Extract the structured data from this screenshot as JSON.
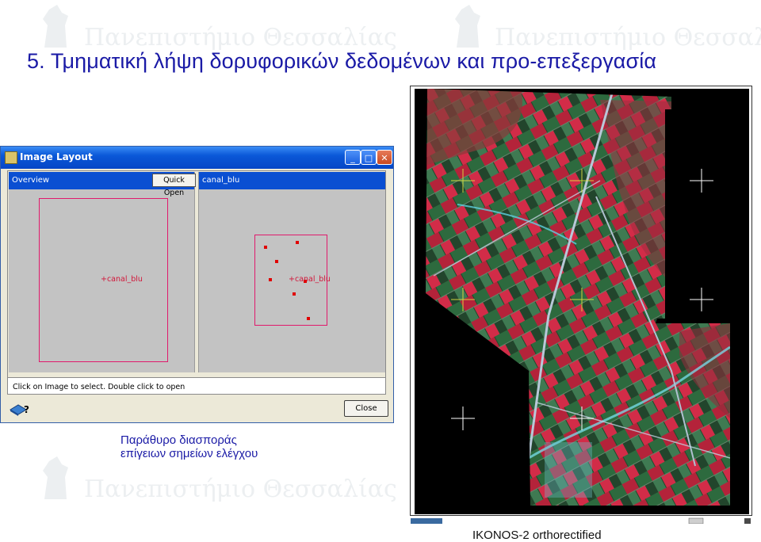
{
  "watermark": {
    "text": "Πανεπιστήμιο Θεσσαλίας"
  },
  "slide": {
    "title": "5. Τμηματική λήψη δορυφορικών δεδομένων και προ-επεξεργασία",
    "caption_line1": "Παράθυρο διασποράς",
    "caption_line2": "επίγειων σημείων ελέγχου",
    "image_label": "IKONOS-2 orthorectified"
  },
  "window": {
    "title": "Image Layout",
    "minimize_symbol": "_",
    "maximize_symbol": "□",
    "close_symbol": "✕",
    "overview_label": "Overview",
    "quick_open_label": "Quick Open",
    "detail_label": "canal_blu",
    "overview_image_label": "+canal_blu",
    "detail_image_label": "+canal_blu",
    "status_text": "Click on Image to select. Double click to open",
    "close_button_label": "Close",
    "help_icon": "help-pointer-icon"
  },
  "colors": {
    "title_text": "#1a1aa6",
    "frame_border": "#e01a6c",
    "gcp_marker": "#e00000",
    "panel_header": "#0a4fd2",
    "panel_bg": "#c3c3c3"
  }
}
